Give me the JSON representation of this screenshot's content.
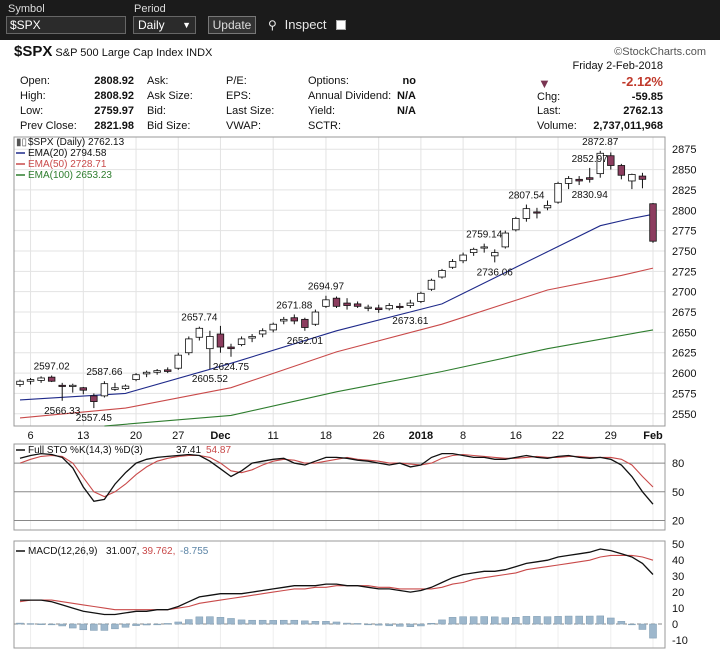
{
  "toolbar": {
    "symbol_label": "Symbol",
    "symbol_value": "$SPX",
    "period_label": "Period",
    "period_value": "Daily",
    "update_label": "Update",
    "inspect_label": "Inspect"
  },
  "header": {
    "symbol": "$SPX",
    "name": "S&P 500 Large Cap Index",
    "exchange": "INDX",
    "brand": "©StockCharts.com",
    "date": "Friday  2-Feb-2018",
    "change_pct": "-2.12%",
    "chg_label": "Chg:",
    "chg_value": "-59.85",
    "last_label": "Last:",
    "last_value": "2762.13",
    "volume_label": "Volume:",
    "volume_value": "2,737,011,968",
    "stats": [
      {
        "label": "Open:",
        "value": "2808.92"
      },
      {
        "label": "High:",
        "value": "2808.92"
      },
      {
        "label": "Low:",
        "value": "2759.97"
      },
      {
        "label": "Prev Close:",
        "value": "2821.98"
      }
    ],
    "col2": [
      "Ask:",
      "Ask Size:",
      "Bid:",
      "Bid Size:"
    ],
    "col3": [
      "P/E:",
      "EPS:",
      "Last Size:",
      "VWAP:"
    ],
    "col4": [
      {
        "label": "Options:",
        "value": "no"
      },
      {
        "label": "Annual Dividend:",
        "value": "N/A"
      },
      {
        "label": "Yield:",
        "value": "N/A"
      },
      {
        "label": "SCTR:",
        "value": ""
      }
    ]
  },
  "colors": {
    "up_fill": "#ffffff",
    "down_fill": "#8c3d5f",
    "candle_border": "#111111",
    "ema20": "#1f2a8a",
    "ema50": "#c94a4a",
    "ema100": "#2e7d2e",
    "sto_k": "#111111",
    "sto_d": "#c94a4a",
    "macd": "#111111",
    "signal": "#c94a4a",
    "histogram": "#9db7cc"
  },
  "chart_data": [
    {
      "type": "candlestick",
      "legend": [
        {
          "text": "$SPX (Daily) 2762.13"
        },
        {
          "text": "EMA(20) 2794.58"
        },
        {
          "text": "EMA(50) 2728.71"
        },
        {
          "text": "EMA(100) 2653.23"
        }
      ],
      "ylim": [
        2535,
        2890
      ],
      "yticks": [
        2550,
        2575,
        2600,
        2625,
        2650,
        2675,
        2700,
        2725,
        2750,
        2775,
        2800,
        2825,
        2850,
        2875
      ],
      "xticks": [
        {
          "label": "6",
          "index": 1
        },
        {
          "label": "13",
          "index": 6
        },
        {
          "label": "20",
          "index": 11
        },
        {
          "label": "27",
          "index": 15
        },
        {
          "label": "Dec",
          "index": 19,
          "bold": true
        },
        {
          "label": "11",
          "index": 24
        },
        {
          "label": "18",
          "index": 29
        },
        {
          "label": "26",
          "index": 34
        },
        {
          "label": "2018",
          "index": 38,
          "bold": true
        },
        {
          "label": "8",
          "index": 42
        },
        {
          "label": "16",
          "index": 47
        },
        {
          "label": "22",
          "index": 51
        },
        {
          "label": "29",
          "index": 56
        },
        {
          "label": "Feb",
          "index": 60,
          "bold": true
        }
      ],
      "candles": [
        [
          2586,
          2592,
          2583,
          2590
        ],
        [
          2590,
          2594,
          2586,
          2592
        ],
        [
          2591,
          2596,
          2588,
          2594
        ],
        [
          2595,
          2597,
          2589,
          2590
        ],
        [
          2585,
          2588,
          2566,
          2584
        ],
        [
          2584,
          2587,
          2576,
          2585
        ],
        [
          2582,
          2583,
          2574,
          2579
        ],
        [
          2572,
          2575,
          2557,
          2565
        ],
        [
          2572,
          2590,
          2570,
          2587
        ],
        [
          2580,
          2588,
          2578,
          2582
        ],
        [
          2581,
          2586,
          2579,
          2584
        ],
        [
          2592,
          2600,
          2590,
          2598
        ],
        [
          2599,
          2603,
          2595,
          2601
        ],
        [
          2601,
          2605,
          2598,
          2603
        ],
        [
          2604,
          2607,
          2600,
          2602
        ],
        [
          2606,
          2625,
          2604,
          2622
        ],
        [
          2625,
          2645,
          2622,
          2642
        ],
        [
          2644,
          2657,
          2640,
          2655
        ],
        [
          2630,
          2652,
          2605,
          2645
        ],
        [
          2648,
          2658,
          2625,
          2632
        ],
        [
          2632,
          2636,
          2620,
          2630
        ],
        [
          2635,
          2645,
          2633,
          2642
        ],
        [
          2643,
          2648,
          2638,
          2645
        ],
        [
          2648,
          2655,
          2644,
          2652
        ],
        [
          2653,
          2662,
          2650,
          2660
        ],
        [
          2664,
          2669,
          2660,
          2666
        ],
        [
          2668,
          2672,
          2660,
          2664
        ],
        [
          2666,
          2668,
          2652,
          2656
        ],
        [
          2660,
          2678,
          2658,
          2675
        ],
        [
          2682,
          2695,
          2680,
          2690
        ],
        [
          2692,
          2694,
          2680,
          2682
        ],
        [
          2686,
          2692,
          2678,
          2683
        ],
        [
          2685,
          2688,
          2680,
          2682
        ],
        [
          2680,
          2684,
          2676,
          2681
        ],
        [
          2680,
          2684,
          2674,
          2678
        ],
        [
          2679,
          2686,
          2677,
          2683
        ],
        [
          2682,
          2686,
          2678,
          2681
        ],
        [
          2683,
          2690,
          2680,
          2686
        ],
        [
          2688,
          2700,
          2686,
          2698
        ],
        [
          2703,
          2716,
          2701,
          2714
        ],
        [
          2718,
          2728,
          2716,
          2726
        ],
        [
          2730,
          2740,
          2728,
          2737
        ],
        [
          2738,
          2748,
          2735,
          2745
        ],
        [
          2748,
          2754,
          2744,
          2752
        ],
        [
          2754,
          2759,
          2748,
          2755
        ],
        [
          2744,
          2752,
          2736,
          2748
        ],
        [
          2755,
          2775,
          2753,
          2772
        ],
        [
          2776,
          2792,
          2774,
          2790
        ],
        [
          2790,
          2807,
          2786,
          2802
        ],
        [
          2798,
          2803,
          2790,
          2797
        ],
        [
          2803,
          2812,
          2800,
          2806
        ],
        [
          2810,
          2835,
          2808,
          2833
        ],
        [
          2833,
          2842,
          2826,
          2839
        ],
        [
          2838,
          2842,
          2831,
          2836
        ],
        [
          2840,
          2852,
          2834,
          2838
        ],
        [
          2845,
          2873,
          2840,
          2870
        ],
        [
          2867,
          2871,
          2850,
          2855
        ],
        [
          2855,
          2857,
          2838,
          2843
        ],
        [
          2836,
          2845,
          2826,
          2844
        ],
        [
          2842,
          2846,
          2827,
          2838
        ],
        [
          2808,
          2809,
          2760,
          2762
        ]
      ],
      "ema20_points": [
        [
          0,
          2567
        ],
        [
          10,
          2575
        ],
        [
          20,
          2612
        ],
        [
          30,
          2652
        ],
        [
          40,
          2685
        ],
        [
          47,
          2730
        ],
        [
          55,
          2781
        ],
        [
          58,
          2790
        ],
        [
          60,
          2795
        ]
      ],
      "ema50_points": [
        [
          0,
          2545
        ],
        [
          10,
          2557
        ],
        [
          20,
          2582
        ],
        [
          30,
          2626
        ],
        [
          40,
          2660
        ],
        [
          50,
          2702
        ],
        [
          57,
          2720
        ],
        [
          60,
          2729
        ]
      ],
      "ema100_points": [
        [
          8,
          2535
        ],
        [
          20,
          2548
        ],
        [
          30,
          2577
        ],
        [
          40,
          2602
        ],
        [
          50,
          2630
        ],
        [
          60,
          2653
        ]
      ],
      "labels": [
        {
          "text": "2597.02",
          "index": 3,
          "value": 2597,
          "pos": "above"
        },
        {
          "text": "2587.66",
          "index": 8,
          "value": 2590,
          "pos": "above"
        },
        {
          "text": "2566.33",
          "index": 4,
          "value": 2566,
          "pos": "below"
        },
        {
          "text": "2557.45",
          "index": 7,
          "value": 2557,
          "pos": "below"
        },
        {
          "text": "2657.74",
          "index": 17,
          "value": 2657,
          "pos": "above"
        },
        {
          "text": "2605.52",
          "index": 18,
          "value": 2605,
          "pos": "below"
        },
        {
          "text": "2624.75",
          "index": 20,
          "value": 2620,
          "pos": "below"
        },
        {
          "text": "2671.88",
          "index": 26,
          "value": 2672,
          "pos": "above"
        },
        {
          "text": "2652.01",
          "index": 27,
          "value": 2652,
          "pos": "below"
        },
        {
          "text": "2694.97",
          "index": 29,
          "value": 2695,
          "pos": "above"
        },
        {
          "text": "2673.61",
          "index": 37,
          "value": 2676,
          "pos": "below"
        },
        {
          "text": "2759.14",
          "index": 44,
          "value": 2759,
          "pos": "above"
        },
        {
          "text": "2736.06",
          "index": 45,
          "value": 2736,
          "pos": "below"
        },
        {
          "text": "2807.54",
          "index": 48,
          "value": 2807,
          "pos": "above"
        },
        {
          "text": "2852.97",
          "index": 54,
          "value": 2852,
          "pos": "above"
        },
        {
          "text": "2872.87",
          "index": 55,
          "value": 2873,
          "pos": "above"
        },
        {
          "text": "2830.94",
          "index": 54,
          "value": 2831,
          "pos": "below"
        }
      ]
    },
    {
      "type": "line",
      "legend": [
        {
          "text": "Full STO %K(14,3) %D(3)"
        },
        {
          "text": "37.41"
        },
        {
          "text": "54.87"
        }
      ],
      "ylim": [
        10,
        100
      ],
      "yticks": [
        20,
        50,
        80
      ],
      "k": [
        85,
        88,
        90,
        89,
        86,
        75,
        55,
        40,
        42,
        58,
        70,
        80,
        84,
        86,
        87,
        88,
        89,
        88,
        82,
        74,
        66,
        72,
        80,
        82,
        84,
        85,
        80,
        78,
        82,
        86,
        86,
        85,
        83,
        82,
        80,
        78,
        80,
        76,
        78,
        86,
        90,
        90,
        88,
        86,
        86,
        84,
        84,
        86,
        88,
        86,
        85,
        87,
        88,
        86,
        85,
        86,
        84,
        78,
        66,
        50,
        37
      ],
      "d": [
        80,
        84,
        87,
        88,
        87,
        80,
        65,
        50,
        45,
        50,
        58,
        68,
        76,
        82,
        85,
        87,
        88,
        88,
        86,
        80,
        72,
        70,
        73,
        78,
        82,
        84,
        83,
        80,
        80,
        82,
        84,
        86,
        84,
        83,
        82,
        80,
        80,
        79,
        78,
        80,
        85,
        88,
        89,
        88,
        87,
        86,
        85,
        85,
        86,
        87,
        86,
        86,
        87,
        87,
        86,
        86,
        86,
        84,
        78,
        66,
        55
      ]
    },
    {
      "type": "line",
      "legend": [
        {
          "text": "MACD(12,26,9)"
        },
        {
          "text": "31.007,"
        },
        {
          "text": "39.762,"
        },
        {
          "text": "-8.755"
        }
      ],
      "ylim": [
        -15,
        52
      ],
      "yticks": [
        -10,
        0,
        10,
        20,
        30,
        40,
        50
      ],
      "macd": [
        15,
        15,
        15,
        14,
        12,
        10,
        8,
        7,
        6,
        6,
        7,
        8,
        8,
        9,
        9,
        11,
        14,
        17,
        18,
        19,
        19,
        19,
        20,
        21,
        22,
        23,
        24,
        24,
        24,
        25,
        25,
        24,
        24,
        23,
        22,
        22,
        21,
        20,
        21,
        23,
        26,
        29,
        31,
        32,
        33,
        33,
        34,
        36,
        38,
        39,
        40,
        42,
        43,
        44,
        45,
        47,
        46,
        44,
        42,
        38,
        31
      ],
      "signal": [
        14,
        15,
        15,
        15,
        14,
        13,
        12,
        11,
        10,
        9,
        9,
        9,
        9,
        9,
        9,
        10,
        11,
        13,
        14,
        15,
        16,
        17,
        18,
        19,
        20,
        21,
        22,
        22,
        23,
        23,
        24,
        24,
        24,
        24,
        23,
        23,
        22,
        22,
        22,
        22,
        23,
        25,
        26,
        28,
        29,
        30,
        31,
        32,
        34,
        35,
        36,
        37,
        38,
        39,
        40,
        42,
        43,
        43,
        43,
        42,
        40
      ],
      "histogram": [
        0.6,
        0.3,
        0.1,
        -0.3,
        -1.2,
        -2.5,
        -3.6,
        -4,
        -4,
        -3,
        -2,
        -1,
        -0.6,
        0,
        0.4,
        1.3,
        2.8,
        4.5,
        4.6,
        4.2,
        3.5,
        2.6,
        2.4,
        2.4,
        2.3,
        2.4,
        2.4,
        2,
        1.7,
        1.7,
        1.3,
        0.6,
        0.4,
        -0.3,
        -0.7,
        -1.1,
        -1.4,
        -1.7,
        -1.2,
        0.5,
        2.6,
        4.2,
        4.6,
        4.6,
        4.7,
        4.5,
        4,
        4.2,
        4.8,
        4.8,
        4.6,
        4.8,
        5,
        5,
        5,
        5.1,
        3.8,
        1.7,
        -0.5,
        -3.4,
        -8.8
      ]
    }
  ]
}
